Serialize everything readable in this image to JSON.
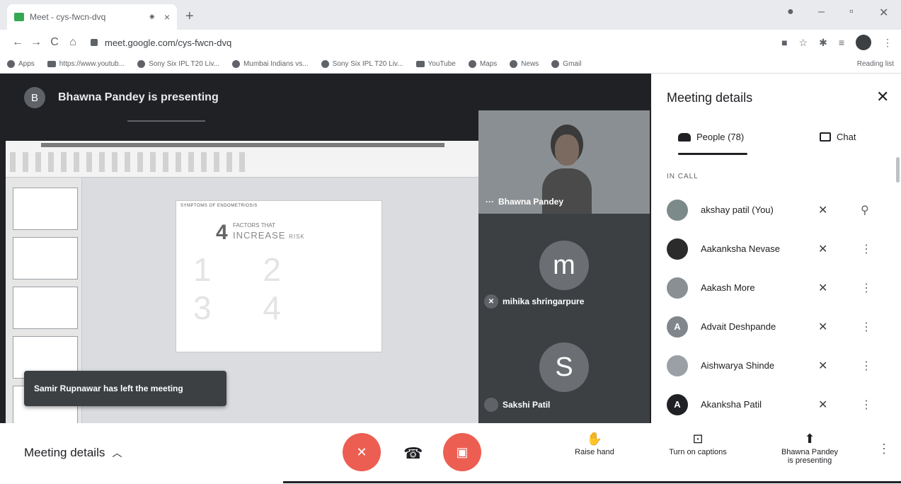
{
  "browser": {
    "tab_title": "Meet - cys-fwcn-dvq",
    "tab_close": "×",
    "new_tab": "+",
    "url": "meet.google.com/cys-fwcn-dvq",
    "nav": {
      "back": "←",
      "forward": "→",
      "reload": "C",
      "home": "⌂"
    },
    "bookmarks": [
      {
        "label": "Apps",
        "icon": "apps-icon"
      },
      {
        "label": "https://www.youtub...",
        "icon": "youtube-icon"
      },
      {
        "label": "Sony Six IPL T20 Liv...",
        "icon": "globe-icon"
      },
      {
        "label": "Mumbai Indians vs...",
        "icon": "globe-icon"
      },
      {
        "label": "Sony Six IPL T20 Liv...",
        "icon": "globe-icon"
      },
      {
        "label": "YouTube",
        "icon": "youtube-icon"
      },
      {
        "label": "Maps",
        "icon": "maps-icon"
      },
      {
        "label": "News",
        "icon": "news-icon"
      },
      {
        "label": "Gmail",
        "icon": "gmail-icon"
      }
    ],
    "reading_list": "Reading list"
  },
  "stage": {
    "presenter_avatar": "B",
    "presenter_text": "Bhawna Pandey is presenting",
    "slide": {
      "header": "SYMPTOMS OF ENDOMETRIOSIS",
      "big_number": "4",
      "factors_text": "FACTORS THAT",
      "increase_text": "INCREASE",
      "risk_text": "RISK",
      "numbers": "1 2 3 4"
    },
    "tiles": [
      {
        "name": "Bhawna Pandey",
        "prefix": "···"
      },
      {
        "name": "mihika shringarpure",
        "avatar": "m"
      },
      {
        "name": "Sakshi Patil",
        "avatar": "S"
      }
    ],
    "toast": "Samir Rupnawar has left the meeting"
  },
  "panel": {
    "title": "Meeting details",
    "close": "✕",
    "tab_people": "People (78)",
    "tab_chat": "Chat",
    "section_label": "IN CALL",
    "people": [
      {
        "name": "akshay patil (You)",
        "avatar": "",
        "avatar_color": "#7d8a8a",
        "action": "pin"
      },
      {
        "name": "Aakanksha Nevase",
        "avatar": "",
        "avatar_color": "#2b2b2b",
        "action": "more"
      },
      {
        "name": "Aakash More",
        "avatar": "",
        "avatar_color": "#8a8f93",
        "action": "more"
      },
      {
        "name": "Advait Deshpande",
        "avatar": "A",
        "avatar_color": "#80868b",
        "action": "more"
      },
      {
        "name": "Aishwarya Shinde",
        "avatar": "",
        "avatar_color": "#9aa0a6",
        "action": "more"
      },
      {
        "name": "Akanksha Patil",
        "avatar": "A",
        "avatar_color": "#202124",
        "action": "more"
      }
    ]
  },
  "bottombar": {
    "meeting_details": "Meeting details",
    "raise_hand": "Raise hand",
    "captions": "Turn on captions",
    "presenting_line1": "Bhawna Pandey",
    "presenting_line2": "is presenting"
  },
  "colors": {
    "accent_red": "#ea4335",
    "stage_bg": "#202124",
    "tile_bg": "#3c4043"
  }
}
